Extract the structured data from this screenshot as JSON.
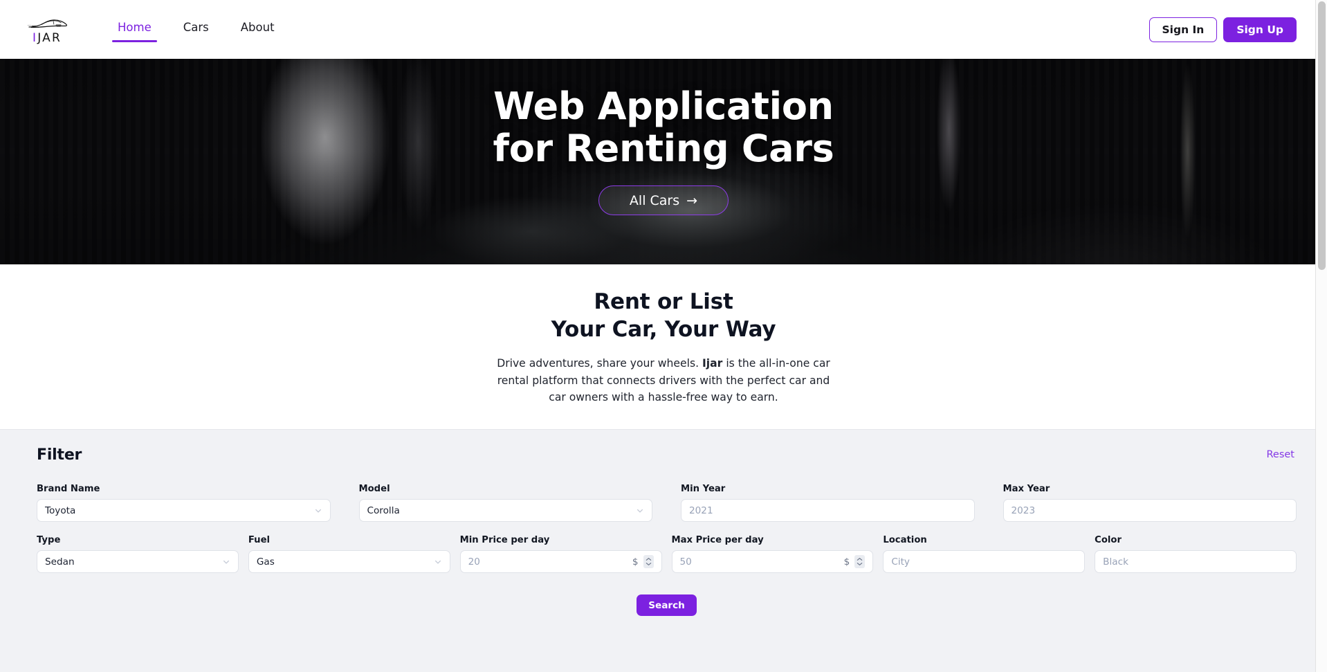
{
  "brand": {
    "name": "IJAR",
    "initial": "I",
    "rest": "JAR",
    "accent_color": "#7c21e0"
  },
  "header": {
    "nav": [
      {
        "label": "Home",
        "active": true
      },
      {
        "label": "Cars",
        "active": false
      },
      {
        "label": "About",
        "active": false
      }
    ],
    "sign_in_label": "Sign In",
    "sign_up_label": "Sign Up"
  },
  "hero": {
    "title_line1": "Web Application",
    "title_line2": "for Renting Cars",
    "cta_label": "All Cars",
    "cta_arrow": "→"
  },
  "intro": {
    "title_line1": "Rent or List",
    "title_line2": "Your Car, Your Way",
    "text_before": "Drive adventures, share your wheels. ",
    "text_brand": "Ijar",
    "text_after": " is the all-in-one car rental platform that connects drivers with the perfect car and car owners with a hassle-free way to earn."
  },
  "filter": {
    "title": "Filter",
    "reset_label": "Reset",
    "search_label": "Search",
    "row1": [
      {
        "label": "Brand Name",
        "kind": "select",
        "value": "Toyota",
        "icon": "chevron-down-icon"
      },
      {
        "label": "Model",
        "kind": "select",
        "value": "Corolla",
        "icon": "chevron-down-icon"
      },
      {
        "label": "Min Year",
        "kind": "input",
        "value": "",
        "placeholder": "2021"
      },
      {
        "label": "Max Year",
        "kind": "input",
        "value": "",
        "placeholder": "2023"
      }
    ],
    "row2": [
      {
        "label": "Type",
        "kind": "select",
        "value": "Sedan",
        "icon": "chevron-down-icon"
      },
      {
        "label": "Fuel",
        "kind": "select",
        "value": "Gas",
        "icon": "chevron-down-icon"
      },
      {
        "label": "Min Price per day",
        "kind": "number",
        "value": "",
        "placeholder": "20",
        "suffix": "$"
      },
      {
        "label": "Max Price per day",
        "kind": "number",
        "value": "",
        "placeholder": "50",
        "suffix": "$"
      },
      {
        "label": "Location",
        "kind": "input",
        "value": "",
        "placeholder": "City"
      },
      {
        "label": "Color",
        "kind": "input",
        "value": "",
        "placeholder": "Black"
      }
    ]
  },
  "colors": {
    "accent": "#7c21e0",
    "filter_bg": "#f1f2f5",
    "hero_bg": "#0a0a0c",
    "text": "#0e1321"
  }
}
